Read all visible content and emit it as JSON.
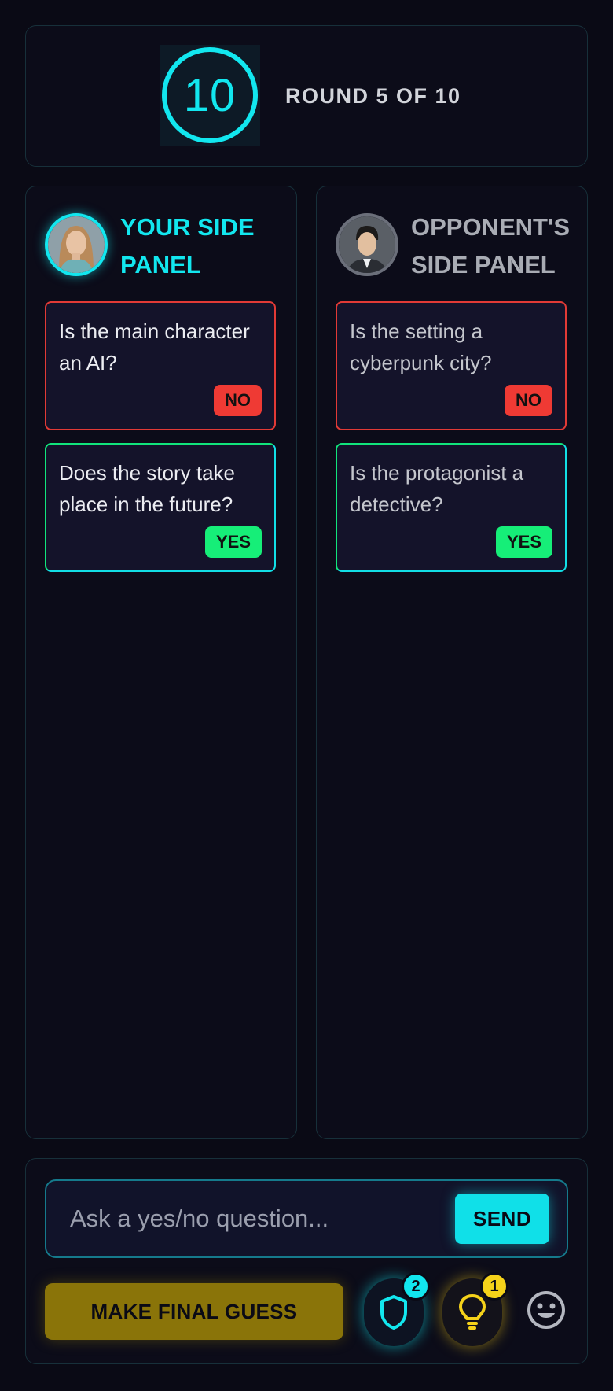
{
  "header": {
    "timer_value": "10",
    "round_label": "ROUND 5 OF 10"
  },
  "your_panel": {
    "title": "YOUR SIDE PANEL",
    "questions": [
      {
        "text": "Is the main character an AI?",
        "answer": "NO"
      },
      {
        "text": "Does the story take place in the future?",
        "answer": "YES"
      }
    ]
  },
  "opponent_panel": {
    "title": "OPPONENT'S SIDE PANEL",
    "questions": [
      {
        "text": "Is the setting a cyberpunk city?",
        "answer": "NO"
      },
      {
        "text": "Is the protagonist a detective?",
        "answer": "YES"
      }
    ]
  },
  "controls": {
    "ask_placeholder": "Ask a yes/no question...",
    "ask_value": "",
    "send_label": "SEND",
    "final_guess_label": "MAKE FINAL GUESS",
    "shield_count": "2",
    "hint_count": "1",
    "icons": {
      "shield": "shield-icon",
      "hint": "lightbulb-icon",
      "emoji": "smiley-icon"
    }
  },
  "colors": {
    "accent": "#12e7ef",
    "no": "#ef3a34",
    "yes": "#16ee78",
    "gold": "#f5d21a"
  }
}
